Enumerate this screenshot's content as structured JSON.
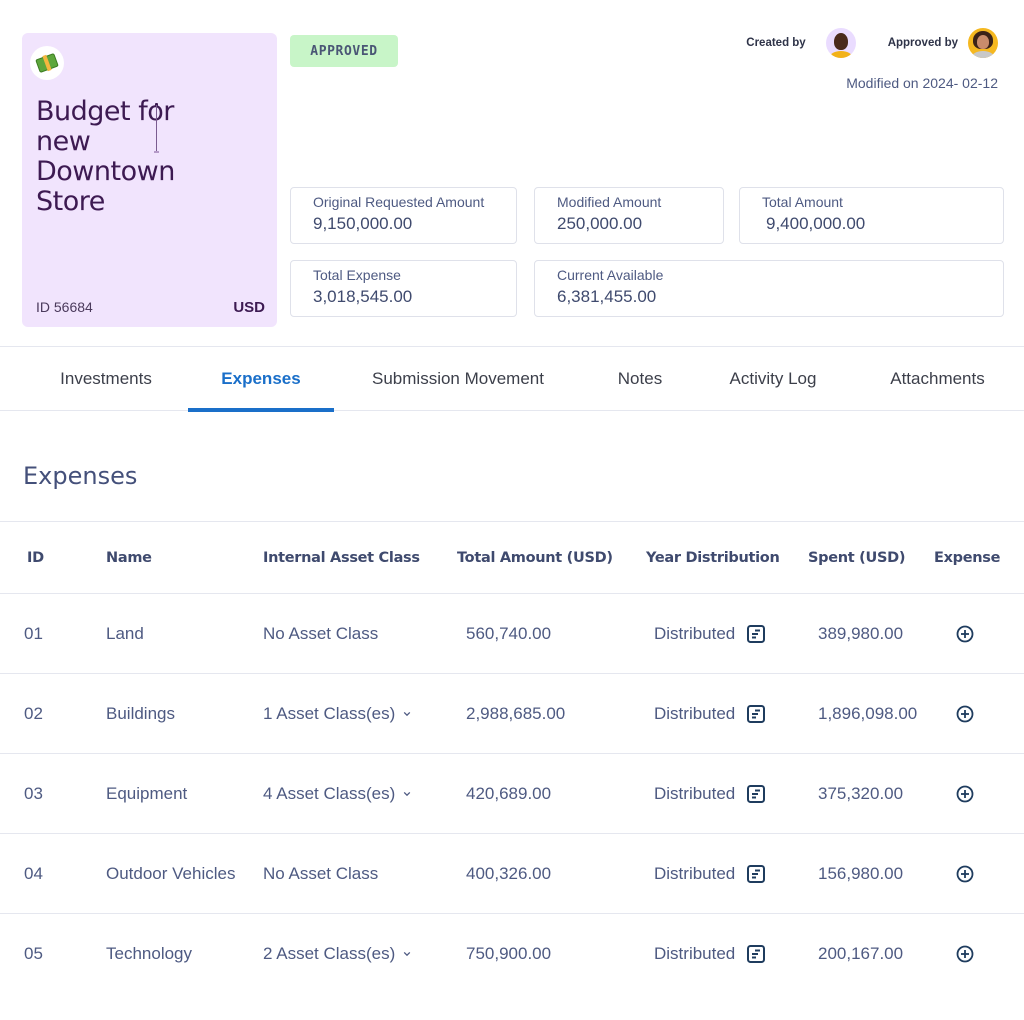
{
  "card": {
    "icon": "money-bills-icon",
    "title": "Budget for new Downtown Store",
    "id_label": "ID 56684",
    "currency": "USD"
  },
  "status": {
    "label": "APPROVED",
    "color": "#c8f5c8"
  },
  "meta": {
    "created_by_label": "Created by",
    "approved_by_label": "Approved by",
    "modified_on": "Modified on 2024- 02-12"
  },
  "amounts": {
    "original_requested": {
      "label": "Original Requested Amount",
      "value": "9,150,000.00"
    },
    "modified": {
      "label": "Modified Amount",
      "value": "250,000.00"
    },
    "total": {
      "label": "Total Amount",
      "value": "9,400,000.00"
    },
    "total_expense": {
      "label": "Total Expense",
      "value": "3,018,545.00"
    },
    "current_available": {
      "label": "Current Available",
      "value": "6,381,455.00"
    }
  },
  "tabs": [
    {
      "label": "Investments",
      "active": false
    },
    {
      "label": "Expenses",
      "active": true
    },
    {
      "label": "Submission Movement",
      "active": false
    },
    {
      "label": "Notes",
      "active": false
    },
    {
      "label": "Activity Log",
      "active": false
    },
    {
      "label": "Attachments",
      "active": false
    }
  ],
  "accent_color": "#1a6fc9",
  "section": {
    "title": "Expenses",
    "columns": {
      "id": "ID",
      "name": "Name",
      "asset_class": "Internal Asset Class",
      "total": "Total Amount (USD)",
      "distribution": "Year Distribution",
      "spent": "Spent (USD)",
      "expense": "Expense"
    },
    "rows": [
      {
        "id": "01",
        "name": "Land",
        "asset_class": "No Asset Class",
        "expandable": false,
        "total": "560,740.00",
        "distribution": "Distributed",
        "spent": "389,980.00"
      },
      {
        "id": "02",
        "name": "Buildings",
        "asset_class": "1 Asset Class(es)",
        "expandable": true,
        "total": "2,988,685.00",
        "distribution": "Distributed",
        "spent": "1,896,098.00"
      },
      {
        "id": "03",
        "name": "Equipment",
        "asset_class": "4 Asset Class(es)",
        "expandable": true,
        "total": "420,689.00",
        "distribution": "Distributed",
        "spent": "375,320.00"
      },
      {
        "id": "04",
        "name": "Outdoor Vehicles",
        "asset_class": "No Asset Class",
        "expandable": false,
        "total": "400,326.00",
        "distribution": "Distributed",
        "spent": "156,980.00"
      },
      {
        "id": "05",
        "name": "Technology",
        "asset_class": "2 Asset Class(es)",
        "expandable": true,
        "total": "750,900.00",
        "distribution": "Distributed",
        "spent": "200,167.00"
      }
    ]
  }
}
